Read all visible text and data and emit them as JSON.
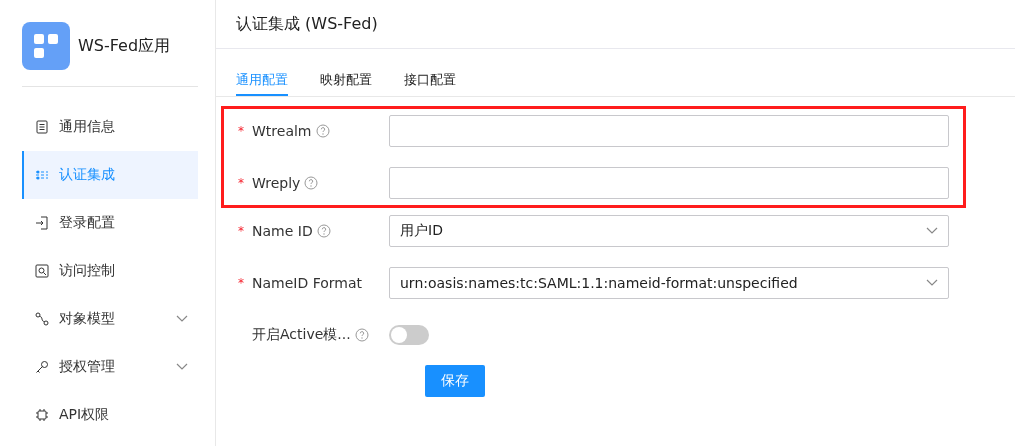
{
  "app": {
    "name": "WS-Fed应用"
  },
  "sidebar": {
    "items": [
      {
        "label": "通用信息",
        "selected": false,
        "has_children": false
      },
      {
        "label": "认证集成",
        "selected": true,
        "has_children": false
      },
      {
        "label": "登录配置",
        "selected": false,
        "has_children": false
      },
      {
        "label": "访问控制",
        "selected": false,
        "has_children": false
      },
      {
        "label": "对象模型",
        "selected": false,
        "has_children": true
      },
      {
        "label": "授权管理",
        "selected": false,
        "has_children": true
      },
      {
        "label": "API权限",
        "selected": false,
        "has_children": false
      }
    ]
  },
  "page": {
    "title": "认证集成 (WS-Fed)"
  },
  "tabs": [
    {
      "label": "通用配置",
      "selected": true
    },
    {
      "label": "映射配置",
      "selected": false
    },
    {
      "label": "接口配置",
      "selected": false
    }
  ],
  "form": {
    "required_mark": "*",
    "rows": [
      {
        "kind": "text",
        "label": "Wtrealm",
        "required": true,
        "help": true,
        "highlighted": true
      },
      {
        "kind": "text",
        "label": "Wreply",
        "required": true,
        "help": true,
        "highlighted": true
      },
      {
        "kind": "select",
        "label": "Name ID",
        "required": true,
        "help": true,
        "highlighted": false,
        "value": "用户ID"
      },
      {
        "kind": "select",
        "label": "NameID Format",
        "required": true,
        "help": false,
        "highlighted": false,
        "value": "urn:oasis:names:tc:SAML:1.1:nameid-format:unspecified"
      },
      {
        "kind": "switch",
        "label": "开启Active模...",
        "required": false,
        "help": true,
        "highlighted": false,
        "on": false
      }
    ],
    "submit": "保存"
  }
}
